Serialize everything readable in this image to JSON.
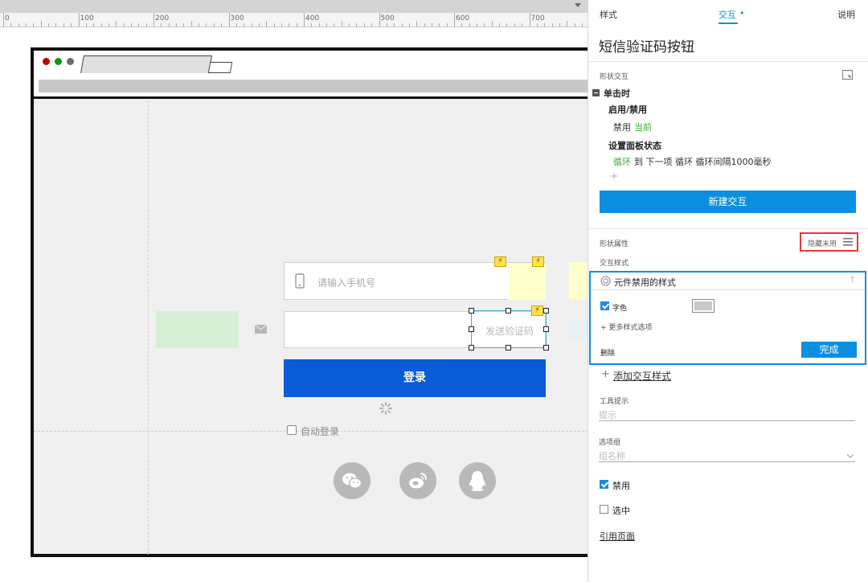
{
  "ruler": {
    "labels": [
      "0",
      "100",
      "200",
      "300",
      "400",
      "500",
      "600",
      "700"
    ]
  },
  "canvas": {
    "phone_placeholder": "请输入手机号",
    "send_code_label": "发送验证码",
    "login_button": "登录",
    "auto_login": "自动登录",
    "flag_glyph": "⚡"
  },
  "panel": {
    "tabs": {
      "style": "样式",
      "interaction": "交互",
      "notes": "说明"
    },
    "title": "短信验证码按钮",
    "shape_interaction": "形状交互",
    "on_click": "单击时",
    "enable_disable": "启用/禁用",
    "disable_label": "禁用",
    "current_label": "当前",
    "set_panel_state": "设置面板状态",
    "loop_label": "循环",
    "loop_rest": "到 下一项 循环 循环间隔1000毫秒",
    "plus": "+",
    "new_interaction": "新建交互",
    "shape_props": "形状属性",
    "hide_unused": "隐藏未用",
    "interaction_styles": "交互样式",
    "disabled_style": "元件禁用的样式",
    "t_mark": "T",
    "font_color": "字色",
    "more_styles": "+ 更多样式选项",
    "delete": "删除",
    "done": "完成",
    "add_interaction_style": "添加交互样式",
    "tooltip_label": "工具提示",
    "tooltip_placeholder": "提示",
    "option_group_label": "选项组",
    "group_name_placeholder": "组名称",
    "disabled_check": "禁用",
    "selected_check": "选中",
    "ref_page": "引用页面"
  },
  "colors": {
    "accent": "#0d8fe0",
    "login": "#0a5bd7",
    "green": "#3aaa35",
    "highlight_red": "#e53935"
  }
}
